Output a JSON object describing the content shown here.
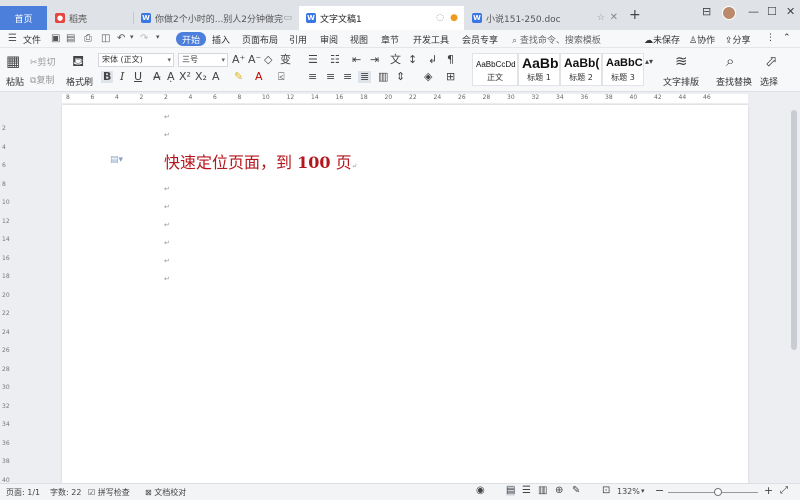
{
  "tabs": {
    "home": "首页",
    "items": [
      {
        "label": "稻壳",
        "icon": "daoke-icon"
      },
      {
        "label": "你做2个小时的...别人2分钟做完",
        "icon": "wps-writer-icon"
      },
      {
        "label": "文字文稿1",
        "icon": "wps-writer-icon",
        "active": true
      },
      {
        "label": "小说151-250.doc",
        "icon": "wps-writer-icon"
      }
    ],
    "new_tab": "+"
  },
  "menu": {
    "file": "文件",
    "items": [
      "开始",
      "插入",
      "页面布局",
      "引用",
      "审阅",
      "视图",
      "章节",
      "开发工具",
      "会员专享"
    ],
    "search": "查找命令、搜索模板",
    "unsaved": "未保存",
    "collaborate": "协作",
    "share": "分享"
  },
  "ribbon": {
    "paste": "粘贴",
    "cut": "剪切",
    "copy": "复制",
    "format_painter": "格式刷",
    "font_name": "宋体 (正文)",
    "font_size": "三号",
    "styles": [
      {
        "sample": "AaBbCcDd",
        "name": "正文"
      },
      {
        "sample": "AaBb",
        "name": "标题 1"
      },
      {
        "sample": "AaBb(",
        "name": "标题 2"
      },
      {
        "sample": "AaBbC(",
        "name": "标题 3"
      }
    ],
    "text_layout": "文字排版",
    "find_replace": "查找替换",
    "select": "选择"
  },
  "ruler": {
    "h": [
      "8",
      "6",
      "4",
      "2",
      "2",
      "4",
      "6",
      "8",
      "10",
      "12",
      "14",
      "16",
      "18",
      "20",
      "22",
      "24",
      "26",
      "28",
      "30",
      "32",
      "34",
      "36",
      "38",
      "40",
      "42",
      "44",
      "46"
    ],
    "v": [
      "2",
      "4",
      "6",
      "8",
      "10",
      "12",
      "14",
      "16",
      "18",
      "20",
      "22",
      "24",
      "26",
      "28",
      "30",
      "32",
      "34",
      "36",
      "38",
      "40"
    ]
  },
  "document": {
    "heading_prefix": "快速定位页面，到 ",
    "heading_number": "100",
    "heading_suffix": " 页",
    "para_mark": "↵"
  },
  "status": {
    "page": "页面: 1/1",
    "words": "字数: 22",
    "spell_check": "拼写检查",
    "proofread": "文档校对",
    "zoom": "132%",
    "zoom_level": 0.55
  }
}
